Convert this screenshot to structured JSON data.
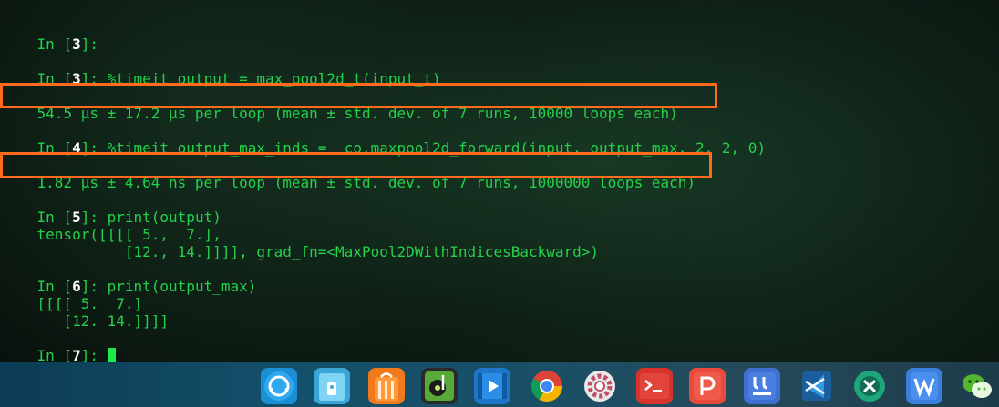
{
  "terminal": {
    "lines": [
      {
        "prefix": "In [",
        "num": "3",
        "suffix": "]:",
        "code": ""
      },
      {
        "prefix": "In [",
        "num": "3",
        "suffix": "]: ",
        "code": "%timeit output = max_pool2d_t(input_t)"
      },
      {
        "text": "54.5 µs ± 17.2 µs per loop (mean ± std. dev. of 7 runs, 10000 loops each)"
      },
      {
        "prefix": "In [",
        "num": "4",
        "suffix": "]: ",
        "code": "%timeit output_max_inds =  co.maxpool2d_forward(input, output_max, 2, 2, 0)"
      },
      {
        "text": "1.82 µs ± 4.64 ns per loop (mean ± std. dev. of 7 runs, 1000000 loops each)"
      },
      {
        "prefix": "In [",
        "num": "5",
        "suffix": "]: ",
        "code": "print(output)"
      },
      {
        "text": "tensor([[[[ 5.,  7.],"
      },
      {
        "text": "          [12., 14.]]]], grad_fn=<MaxPool2DWithIndicesBackward>)"
      },
      {
        "prefix": "In [",
        "num": "6",
        "suffix": "]: ",
        "code": "print(output_max)"
      },
      {
        "text": "[[[[ 5.  7.]"
      },
      {
        "text": "   [12. 14.]]]]"
      },
      {
        "prefix": "In [",
        "num": "7",
        "suffix": "]: ",
        "code": ""
      }
    ],
    "highlight_color": "#ff6a1f",
    "text_color": "#23d14a"
  },
  "dock": {
    "icons": [
      {
        "name": "deepin-launcher-icon",
        "color": "#1b8fd6"
      },
      {
        "name": "file-manager-icon",
        "color": "#3aa6d8"
      },
      {
        "name": "app-store-icon",
        "color": "#f07a1c"
      },
      {
        "name": "music-player-icon",
        "color": "#59a83a"
      },
      {
        "name": "video-player-icon",
        "color": "#1d76c9"
      },
      {
        "name": "chrome-icon",
        "color": "#e04232"
      },
      {
        "name": "settings-icon",
        "color": "#e8e8e8"
      },
      {
        "name": "terminal-icon",
        "color": "#d8332b"
      },
      {
        "name": "wps-presentation-icon",
        "color": "#e84b3b"
      },
      {
        "name": "text-editor-icon",
        "color": "#3f6fd1"
      },
      {
        "name": "vscode-icon",
        "color": "#2a7bd0"
      },
      {
        "name": "remote-desktop-icon",
        "color": "#1ea57a"
      },
      {
        "name": "wps-writer-icon",
        "color": "#3a7fdc"
      },
      {
        "name": "wechat-icon",
        "color": "#53b62f"
      }
    ]
  }
}
